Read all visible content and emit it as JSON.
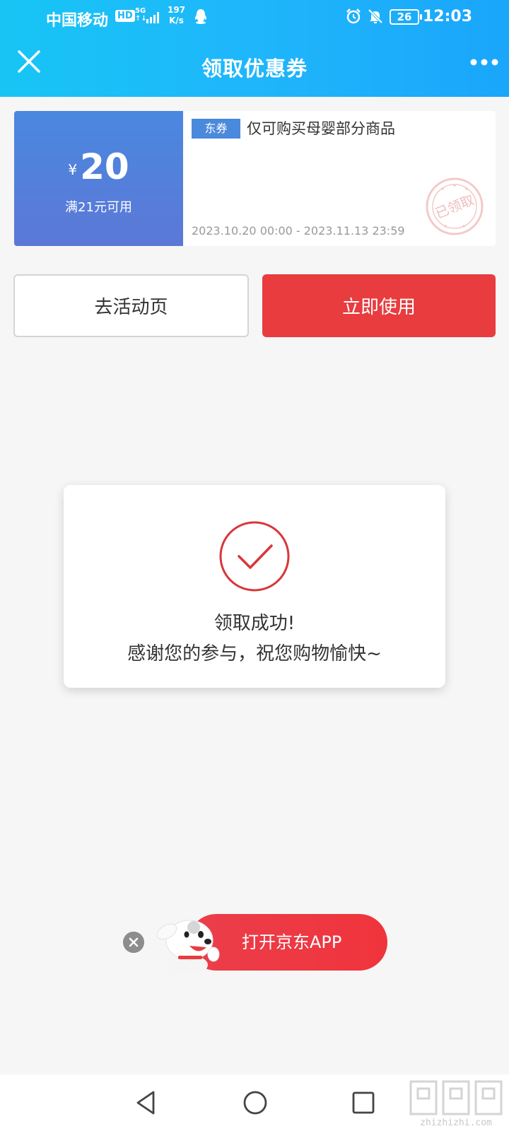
{
  "status_bar": {
    "carrier": "中国移动",
    "hd": "HD",
    "network": "5G",
    "net_sub": "↑↓",
    "speed_value": "197",
    "speed_unit": "K/s",
    "battery": "26",
    "time": "12:03"
  },
  "header": {
    "title": "领取优惠券",
    "close_icon": "close-icon",
    "more_icon": "more-icon"
  },
  "coupon": {
    "currency": "¥",
    "amount": "20",
    "condition": "满21元可用",
    "tag": "东券",
    "description": "仅可购买母婴部分商品",
    "validity": "2023.10.20 00:00 - 2023.11.13 23:59",
    "stamp": "已领取",
    "left_color": "#4a88e0"
  },
  "actions": {
    "activity_label": "去活动页",
    "use_label": "立即使用",
    "use_color": "#e83c3f"
  },
  "dialog": {
    "icon": "check-circle-icon",
    "title": "领取成功!",
    "message": "感谢您的参与，祝您购物愉快~",
    "accent": "#d9353b"
  },
  "banner": {
    "label": "打开京东APP",
    "close_icon": "close-icon",
    "mascot": "joy-dog-mascot"
  },
  "watermark": {
    "text": "zhizhizhi.com"
  }
}
